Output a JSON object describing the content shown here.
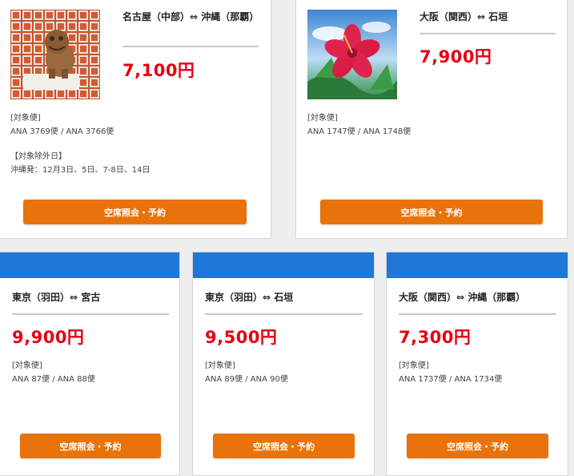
{
  "cards": [
    {
      "route": "名古屋（中部）⇔ 沖縄（那覇）",
      "price": "7,100円",
      "flights_label": "[対象便]",
      "flights": "ANA 3769便 / ANA 3766便",
      "excluded_label": "【対象除外日】",
      "excluded": "沖縄発：12月3日、5日、7-8日、14日",
      "button": "空席照会・予約",
      "image": "shisa-lion-statue-photo"
    },
    {
      "route": "大阪（関西）⇔ 石垣",
      "price": "7,900円",
      "flights_label": "[対象便]",
      "flights": "ANA 1747便 / ANA 1748便",
      "button": "空席照会・予約",
      "image": "hibiscus-flower-photo"
    },
    {
      "route": "東京（羽田）⇔ 宮古",
      "price": "9,900円",
      "flights_label": "[対象便]",
      "flights": "ANA 87便 / ANA 88便",
      "button": "空席照会・予約"
    },
    {
      "route": "東京（羽田）⇔ 石垣",
      "price": "9,500円",
      "flights_label": "[対象便]",
      "flights": "ANA 89便 / ANA 90便",
      "button": "空席照会・予約"
    },
    {
      "route": "大阪（関西）⇔ 沖縄（那覇）",
      "price": "7,300円",
      "flights_label": "[対象便]",
      "flights": "ANA 1737便 / ANA 1734便",
      "button": "空席照会・予約"
    }
  ],
  "colors": {
    "price": "#e60012",
    "button": "#e8730c",
    "header_bar": "#1f78d8"
  }
}
